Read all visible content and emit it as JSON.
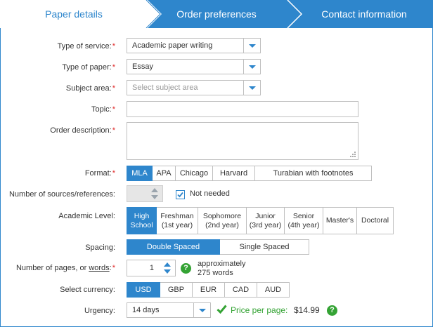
{
  "steps": {
    "items": [
      {
        "label": "Paper details",
        "active": true
      },
      {
        "label": "Order preferences",
        "active": false
      },
      {
        "label": "Contact information",
        "active": false
      }
    ]
  },
  "form": {
    "service": {
      "label": "Type of service:",
      "value": "Academic paper writing"
    },
    "paper": {
      "label": "Type of paper:",
      "value": "Essay"
    },
    "subject": {
      "label": "Subject area:",
      "placeholder": "Select subject area"
    },
    "topic": {
      "label": "Topic:",
      "value": ""
    },
    "description": {
      "label": "Order description:",
      "value": ""
    },
    "format": {
      "label": "Format:",
      "options": [
        "MLA",
        "APA",
        "Chicago",
        "Harvard",
        "Turabian with footnotes"
      ],
      "selected": "MLA"
    },
    "sources": {
      "label": "Number of sources/references:",
      "not_needed_label": "Not needed",
      "not_needed_checked": true
    },
    "level": {
      "label": "Academic Level:",
      "options": [
        [
          "High",
          "School"
        ],
        [
          "Freshman",
          "(1st year)"
        ],
        [
          "Sophomore",
          "(2nd year)"
        ],
        [
          "Junior",
          "(3rd year)"
        ],
        [
          "Senior",
          "(4th year)"
        ],
        [
          "Master's"
        ],
        [
          "Doctoral"
        ]
      ],
      "selected": 0
    },
    "spacing": {
      "label": "Spacing:",
      "options": [
        "Double Spaced",
        "Single Spaced"
      ],
      "selected": "Double Spaced"
    },
    "pages": {
      "label_prefix": "Number of pages, or ",
      "label_link": "words",
      "label_suffix": ":",
      "value": "1",
      "approx_line1": "approximately",
      "approx_line2": "275 words"
    },
    "currency": {
      "label": "Select currency:",
      "options": [
        "USD",
        "GBP",
        "EUR",
        "CAD",
        "AUD"
      ],
      "selected": "USD"
    },
    "urgency": {
      "label": "Urgency:",
      "value": "14 days"
    },
    "price": {
      "label": "Price per page:",
      "value": "$14.99"
    },
    "required_mark": "*",
    "help_glyph": "?"
  },
  "colors": {
    "accent": "#2e86cc",
    "success": "#34a334",
    "required": "#e02424"
  },
  "icons": {
    "dropdown": "chevron-down-icon",
    "help": "help-icon",
    "check": "checkmark-icon",
    "spinner": "spinner-arrows-icon"
  }
}
